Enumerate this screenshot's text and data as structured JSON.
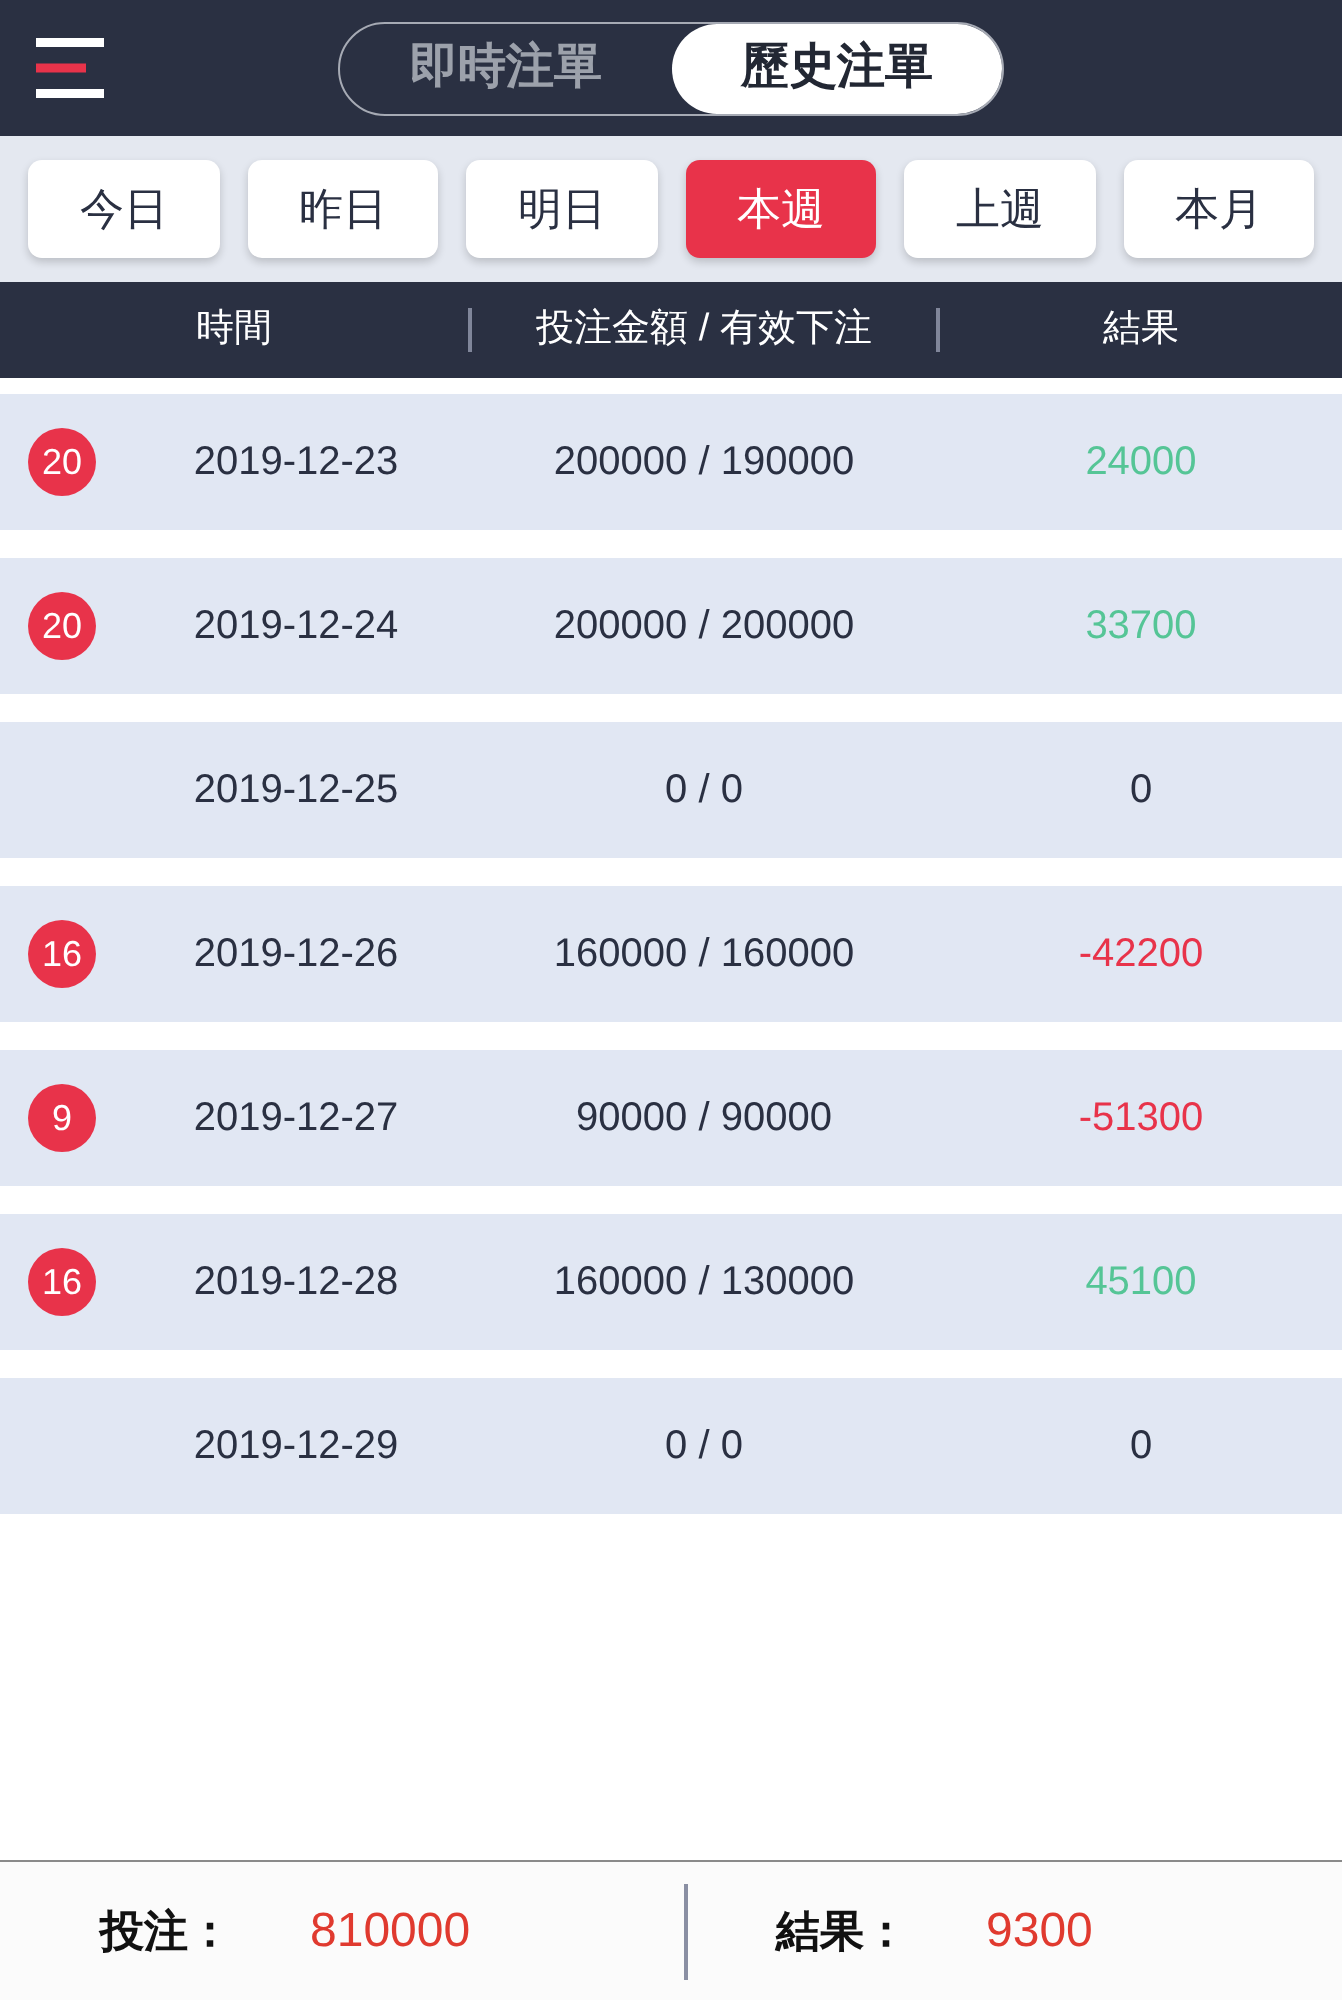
{
  "header": {
    "tabs": [
      {
        "label": "即時注單",
        "selected": false
      },
      {
        "label": "歷史注單",
        "selected": true
      }
    ]
  },
  "filters": [
    {
      "label": "今日",
      "selected": false
    },
    {
      "label": "昨日",
      "selected": false
    },
    {
      "label": "明日",
      "selected": false
    },
    {
      "label": "本週",
      "selected": true
    },
    {
      "label": "上週",
      "selected": false
    },
    {
      "label": "本月",
      "selected": false
    }
  ],
  "columns": [
    "時間",
    "投注金額 / 有效下注",
    "結果"
  ],
  "rows": [
    {
      "badge": "20",
      "date": "2019-12-23",
      "stake": "200000 / 190000",
      "result": "24000",
      "color": "#55c596"
    },
    {
      "badge": "20",
      "date": "2019-12-24",
      "stake": "200000 / 200000",
      "result": "33700",
      "color": "#55c596"
    },
    {
      "date": "2019-12-25",
      "stake": "0 / 0",
      "result": "0",
      "color": "#2a3042"
    },
    {
      "badge": "16",
      "date": "2019-12-26",
      "stake": "160000 / 160000",
      "result": "-42200",
      "color": "#e8334a"
    },
    {
      "badge": "9",
      "date": "2019-12-27",
      "stake": "90000 / 90000",
      "result": "-51300",
      "color": "#e8334a"
    },
    {
      "badge": "16",
      "date": "2019-12-28",
      "stake": "160000 / 130000",
      "result": "45100",
      "color": "#55c596"
    },
    {
      "date": "2019-12-29",
      "stake": "0 / 0",
      "result": "0",
      "color": "#2a3042"
    }
  ],
  "footer": {
    "stake_label": "投注：",
    "stake": "810000",
    "result_label": "結果：",
    "result": "9300"
  }
}
